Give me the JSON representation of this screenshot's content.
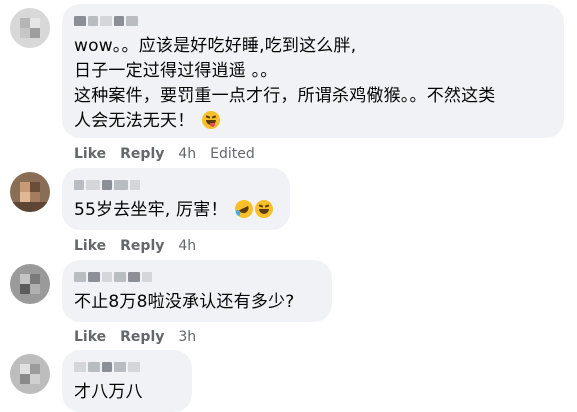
{
  "comments": [
    {
      "body": [
        "wow。。应该是好吃好睡,吃到这么胖,",
        "日子一定过得过得逍遥 。。",
        "这种案件，要罚重一点才行，所谓杀鸡儆猴。。不然这类",
        "人会无法无天！"
      ],
      "emoji": "grinning-squinting-tongue-emoji",
      "like_label": "Like",
      "reply_label": "Reply",
      "time": "4h",
      "edited": "Edited"
    },
    {
      "body": [
        "55岁去坐牢, 厉害！"
      ],
      "emoji": "rolling-laughing-emoji",
      "like_label": "Like",
      "reply_label": "Reply",
      "time": "4h"
    },
    {
      "body": [
        "不止8万8啦没承认还有多少?"
      ],
      "like_label": "Like",
      "reply_label": "Reply",
      "time": "3h"
    },
    {
      "body": [
        "才八万八"
      ]
    }
  ],
  "colors": {
    "bubble": "#f0f2f5",
    "meta": "#65676b",
    "text": "#050505"
  }
}
